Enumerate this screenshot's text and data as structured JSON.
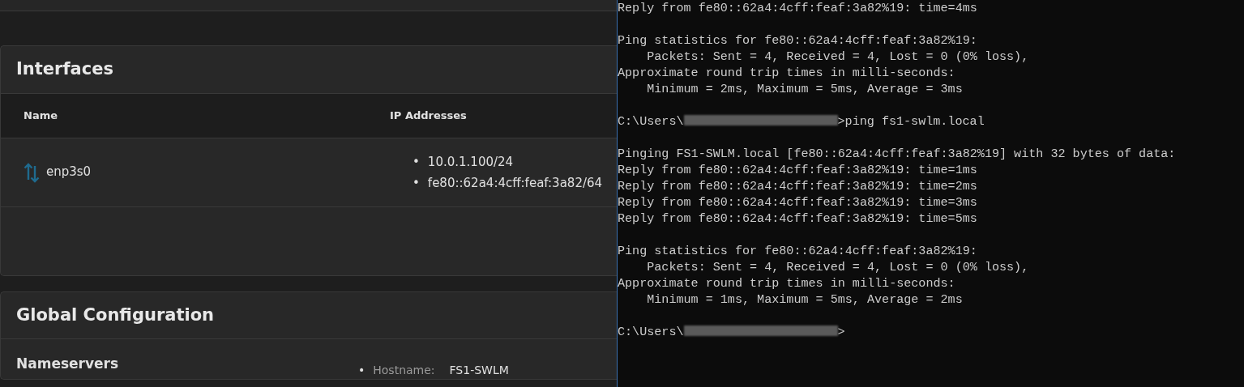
{
  "interfaces": {
    "title": "Interfaces",
    "columns": [
      "Name",
      "IP Addresses"
    ],
    "rows": [
      {
        "name": "enp3s0",
        "bullet": "•",
        "addresses": [
          "10.0.1.100/24",
          "fe80::62a4:4cff:feaf:3a82/64"
        ]
      }
    ]
  },
  "global_configuration": {
    "title": "Global Configuration",
    "nameservers": {
      "title": "Nameservers"
    },
    "settings": [
      {
        "bullet": "•",
        "label": "Hostname:",
        "value": "FS1-SWLM"
      }
    ]
  },
  "terminal": {
    "lines": [
      {
        "kind": "text",
        "text": "Reply from fe80::62a4:4cff:feaf:3a82%19: time=4ms"
      },
      {
        "kind": "blank"
      },
      {
        "kind": "text",
        "text": "Ping statistics for fe80::62a4:4cff:feaf:3a82%19:"
      },
      {
        "kind": "text",
        "text": "    Packets: Sent = 4, Received = 4, Lost = 0 (0% loss),"
      },
      {
        "kind": "text",
        "text": "Approximate round trip times in milli-seconds:"
      },
      {
        "kind": "text",
        "text": "    Minimum = 2ms, Maximum = 5ms, Average = 3ms"
      },
      {
        "kind": "blank"
      },
      {
        "kind": "prompt",
        "prefix": "C:\\Users\\",
        "command": ">ping fs1-swlm.local"
      },
      {
        "kind": "blank"
      },
      {
        "kind": "text",
        "text": "Pinging FS1-SWLM.local [fe80::62a4:4cff:feaf:3a82%19] with 32 bytes of data:"
      },
      {
        "kind": "text",
        "text": "Reply from fe80::62a4:4cff:feaf:3a82%19: time=1ms"
      },
      {
        "kind": "text",
        "text": "Reply from fe80::62a4:4cff:feaf:3a82%19: time=2ms"
      },
      {
        "kind": "text",
        "text": "Reply from fe80::62a4:4cff:feaf:3a82%19: time=3ms"
      },
      {
        "kind": "text",
        "text": "Reply from fe80::62a4:4cff:feaf:3a82%19: time=5ms"
      },
      {
        "kind": "blank"
      },
      {
        "kind": "text",
        "text": "Ping statistics for fe80::62a4:4cff:feaf:3a82%19:"
      },
      {
        "kind": "text",
        "text": "    Packets: Sent = 4, Received = 4, Lost = 0 (0% loss),"
      },
      {
        "kind": "text",
        "text": "Approximate round trip times in milli-seconds:"
      },
      {
        "kind": "text",
        "text": "    Minimum = 1ms, Maximum = 5ms, Average = 2ms"
      },
      {
        "kind": "blank"
      },
      {
        "kind": "prompt",
        "prefix": "C:\\Users\\",
        "command": ">"
      }
    ]
  }
}
